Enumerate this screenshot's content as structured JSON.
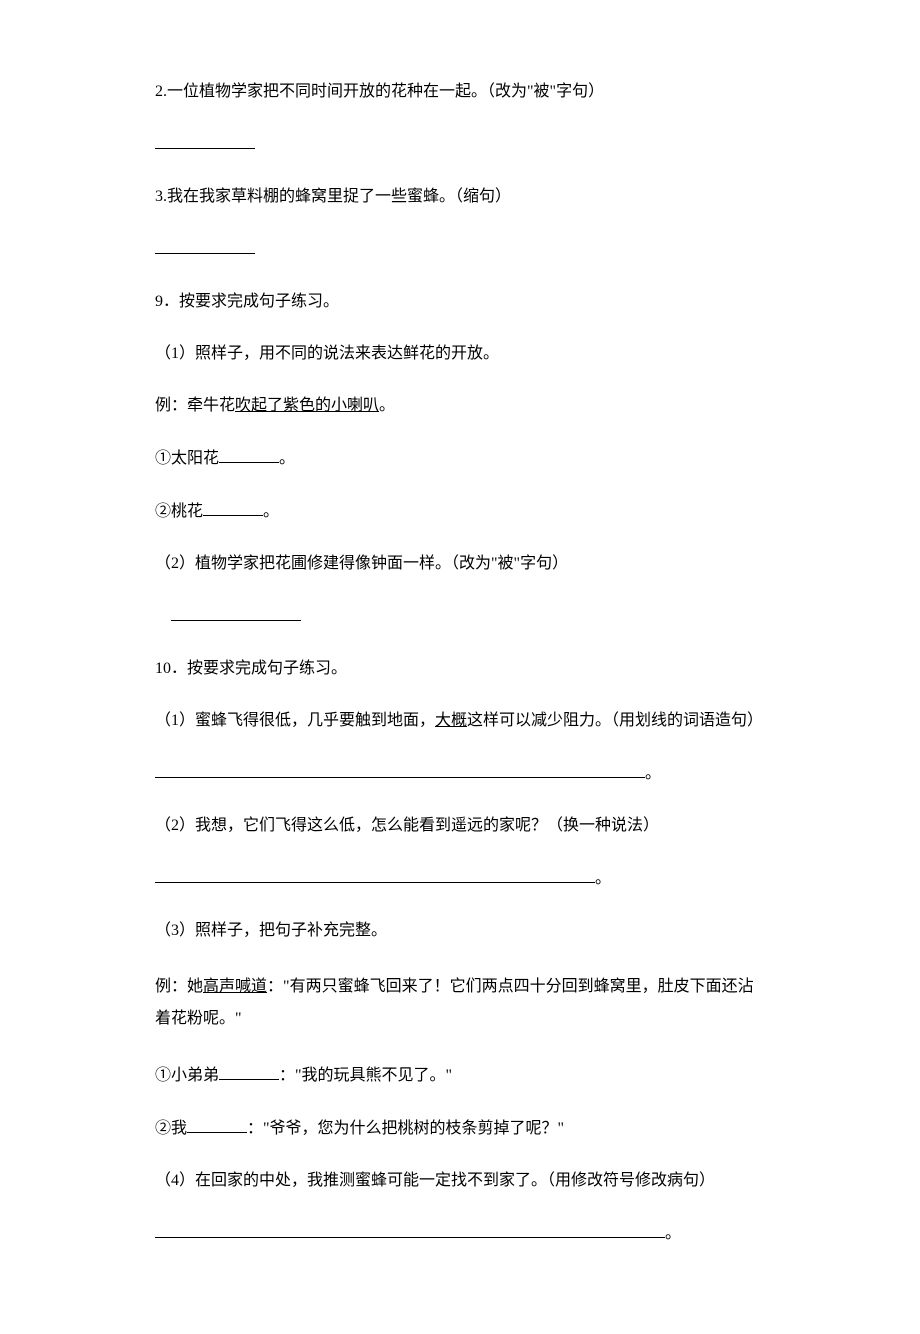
{
  "q2": {
    "text": "2.一位植物学家把不同时间开放的花种在一起。（改为\"被\"字句）"
  },
  "q3": {
    "text": "3.我在我家草料棚的蜂窝里捉了一些蜜蜂。（缩句）"
  },
  "q9": {
    "heading": "9．按要求完成句子练习。",
    "p1": "（1）照样子，用不同的说法来表达鲜花的开放。",
    "ex_prefix": "例：牵牛花",
    "ex_underlined": "吹起了紫色的小喇叭",
    "ex_suffix": "。",
    "item1_prefix": "①太阳花",
    "item1_suffix": "。",
    "item2_prefix": "②桃花",
    "item2_suffix": "。",
    "p2": "（2）植物学家把花圃修建得像钟面一样。（改为\"被\"字句）"
  },
  "q10": {
    "heading": "10．按要求完成句子练习。",
    "p1_prefix": "（1）蜜蜂飞得很低，几乎要触到地面，",
    "p1_underlined": "大概",
    "p1_suffix": "这样可以减少阻力。（用划线的词语造句）",
    "p2": "（2）我想，它们飞得这么低，怎么能看到遥远的家呢？（换一种说法）",
    "p3": "（3）照样子，把句子补充完整。",
    "ex_prefix": "例：她",
    "ex_underlined": "高声喊道",
    "ex_suffix": "：\"有两只蜜蜂飞回来了！它们两点四十分回到蜂窝里，肚皮下面还沾着花粉呢。\"",
    "item1_prefix": "①小弟弟",
    "item1_suffix": "：\"我的玩具熊不见了。\"",
    "item2_prefix": "②我",
    "item2_suffix": "：\"爷爷，您为什么把桃树的枝条剪掉了呢？\"",
    "p4": "（4）在回家的中处，我推测蜜蜂可能一定找不到家了。（用修改符号修改病句）"
  },
  "period": "。"
}
